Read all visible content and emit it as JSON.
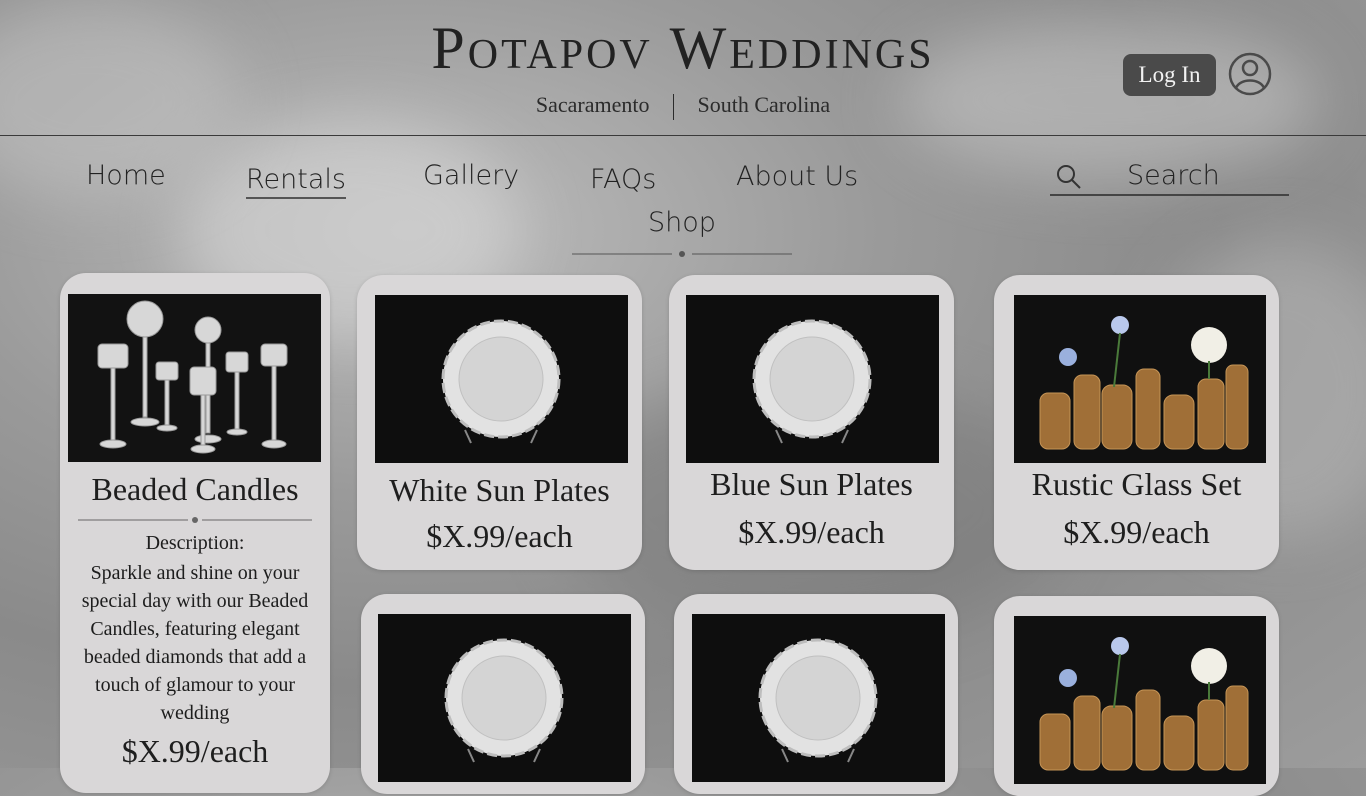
{
  "header": {
    "brand": "Potapov Weddings",
    "locations": [
      "Sacaramento",
      "South Carolina"
    ],
    "login_label": "Log In"
  },
  "nav": {
    "items": [
      "Home",
      "Rentals",
      "Gallery",
      "FAQs",
      "About Us",
      "Shop"
    ],
    "active": "Rentals",
    "search_label": "Search"
  },
  "products": [
    {
      "title": "Beaded Candles",
      "description_label": "Description:",
      "description": "Sparkle and shine on your special day with our Beaded Candles, featuring elegant beaded diamonds that add a touch of glamour to your wedding",
      "price": "$X.99/each",
      "image": "candle-holders"
    },
    {
      "title": "White Sun Plates",
      "price": "$X.99/each",
      "image": "white-plate"
    },
    {
      "title": "Blue Sun Plates",
      "price": "$X.99/each",
      "image": "white-plate"
    },
    {
      "title": "Rustic Glass Set",
      "price": "$X.99/each",
      "image": "glass-vases"
    },
    {
      "image": "white-plate"
    },
    {
      "image": "white-plate"
    },
    {
      "image": "glass-vases"
    }
  ],
  "colors": {
    "card_bg": "#d9d7d8",
    "login_bg": "#4a4a4a",
    "image_bg": "#0f0f0f"
  }
}
